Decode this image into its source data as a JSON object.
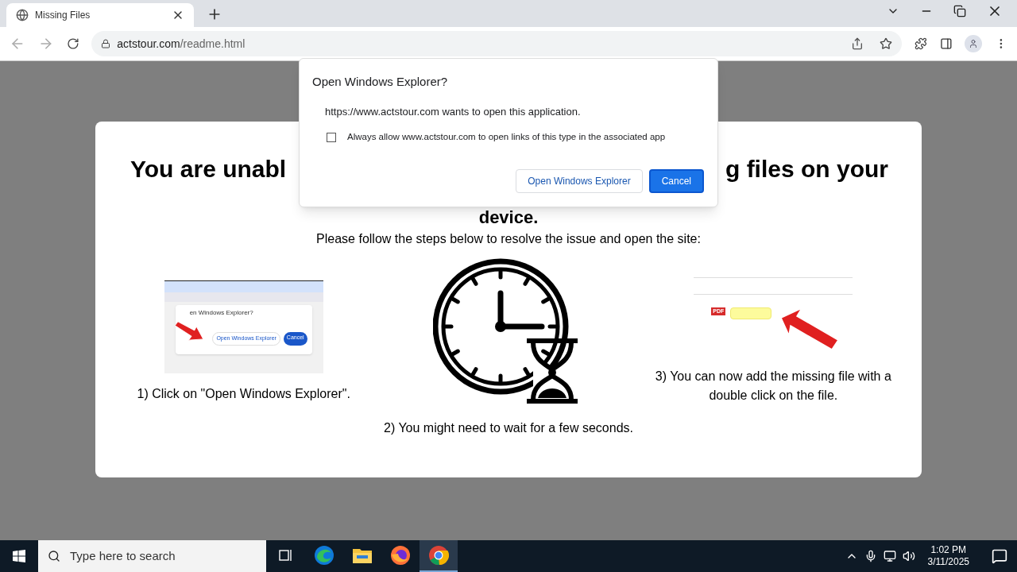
{
  "browser": {
    "tabs": [
      {
        "title": "Missing Files",
        "selected": true
      }
    ],
    "address": {
      "domain": "actstour.com",
      "path": "/readme.html"
    }
  },
  "page": {
    "heading": {
      "left": "You are unabl",
      "right": "g files on your",
      "line_2": "device."
    },
    "intro": "Please follow the steps below to resolve the issue and open the site:",
    "steps": [
      {
        "kind": "screenshot",
        "caption": "1) Click on \"Open Windows Explorer\".",
        "mini_title": "en Windows Explorer?",
        "mini_buttons": [
          "Open Windows Explorer",
          "Cancel"
        ]
      },
      {
        "kind": "clock",
        "caption": "2) You might need to wait for a few seconds."
      },
      {
        "kind": "file",
        "caption": "3) You can now add the missing file with a double click on the file.",
        "file_badge": "PDF"
      }
    ]
  },
  "dialog": {
    "title": "Open Windows Explorer?",
    "message": "https://www.actstour.com wants to open this application.",
    "checkbox": {
      "label": "Always allow www.actstour.com to open links of this type in the associated app",
      "checked": false
    },
    "buttons": [
      {
        "label": "Open Windows Explorer",
        "primary": false
      },
      {
        "label": "Cancel",
        "primary": true
      }
    ]
  },
  "taskbar": {
    "search_placeholder": "Type here to search",
    "apps": [
      {
        "kind": "task-view",
        "selected": false
      },
      {
        "kind": "edge",
        "selected": false
      },
      {
        "kind": "explorer",
        "selected": false
      },
      {
        "kind": "firefox",
        "selected": false
      },
      {
        "kind": "chrome",
        "selected": true
      }
    ],
    "time": "1:02 PM",
    "date": "3/11/2025"
  }
}
